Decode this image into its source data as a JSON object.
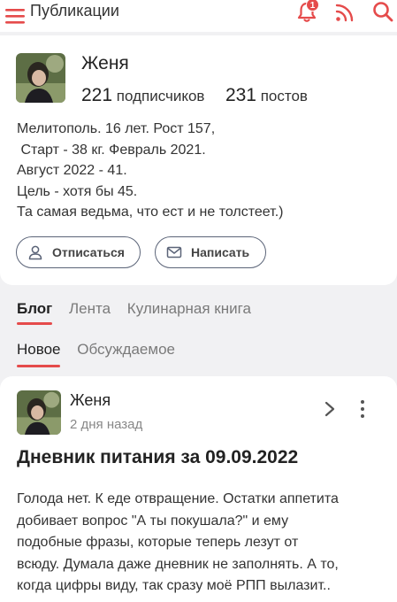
{
  "topbar": {
    "title": "Публикации",
    "notification_count": "1",
    "icons": [
      "hamburger-icon",
      "bell-icon",
      "rss-icon",
      "search-icon"
    ]
  },
  "profile": {
    "name": "Женя",
    "subscribers_count": "221",
    "subscribers_label": "подписчиков",
    "posts_count": "231",
    "posts_label": "постов",
    "bio_lines": [
      "Мелитополь. 16 лет. Рост 157,",
      " Старт - 38 кг. Февраль 2021.",
      "Август 2022 - 41.",
      "Цель - хотя бы 45.",
      "Та самая ведьма, что ест и не толстеет.)"
    ],
    "unsubscribe_label": "Отписаться",
    "message_label": "Написать"
  },
  "tabs": [
    {
      "label": "Блог",
      "active": true
    },
    {
      "label": "Лента",
      "active": false
    },
    {
      "label": "Кулинарная книга",
      "active": false
    }
  ],
  "subtabs": [
    {
      "label": "Новое",
      "active": true
    },
    {
      "label": "Обсуждаемое",
      "active": false
    }
  ],
  "post": {
    "author": "Женя",
    "time": "2 дня назад",
    "title": "Дневник питания за 09.09.2022",
    "text_lines": [
      "Голода нет. К еде отвращение. Остатки аппетита",
      "добивает вопрос \"А ты покушала?\" и ему",
      "подобные фразы, которые теперь лезут от",
      "всюду. Думала даже дневник не заполнять. А то,",
      "когда цифры виду, так сразу моё РПП вылазит.."
    ]
  },
  "colors": {
    "accent": "#e54b4b",
    "background": "#f1f1f3",
    "card": "#ffffff",
    "button_border": "#5b6478"
  }
}
